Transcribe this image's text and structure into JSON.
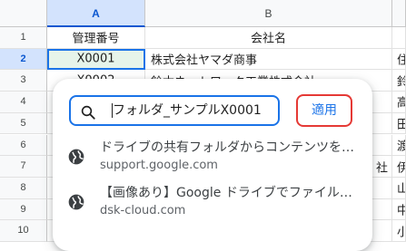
{
  "columns": [
    {
      "id": "A",
      "selected": true
    },
    {
      "id": "B",
      "selected": false
    }
  ],
  "rows": [
    {
      "num": "1",
      "a": "管理番号",
      "b": "会社名",
      "c": ""
    },
    {
      "num": "2",
      "a": "X0001",
      "b": "株式会社ヤマダ商事",
      "c": "住"
    },
    {
      "num": "3",
      "a": "X0002",
      "b": "鈴木ネットワーク工業株式会社",
      "c": "鈴"
    },
    {
      "num": "4",
      "a": "",
      "b": "",
      "c": "高"
    },
    {
      "num": "5",
      "a": "",
      "b": "",
      "c": "田"
    },
    {
      "num": "6",
      "a": "",
      "b": "",
      "c": "渡"
    },
    {
      "num": "7",
      "a": "",
      "b": "社",
      "c": "伊"
    },
    {
      "num": "8",
      "a": "",
      "b": "",
      "c": "山"
    },
    {
      "num": "9",
      "a": "",
      "b": "",
      "c": "中"
    },
    {
      "num": "10",
      "a": "",
      "b": "",
      "c": "小"
    }
  ],
  "popup": {
    "search_value": "フォルダ_サンプルX0001",
    "apply_label": "適用",
    "results": [
      {
        "title": "ドライブの共有フォルダからコンテンツを削除する",
        "url": "support.google.com",
        "icon": "globe-icon"
      },
      {
        "title": "【画像あり】Google ドライブでファイルを共有する方法",
        "url": "dsk-cloud.com",
        "icon": "globe-icon"
      }
    ]
  },
  "colors": {
    "accent": "#1a73e8",
    "apply_highlight": "#e53935",
    "active_cell_fill": "#e6f4ea"
  }
}
